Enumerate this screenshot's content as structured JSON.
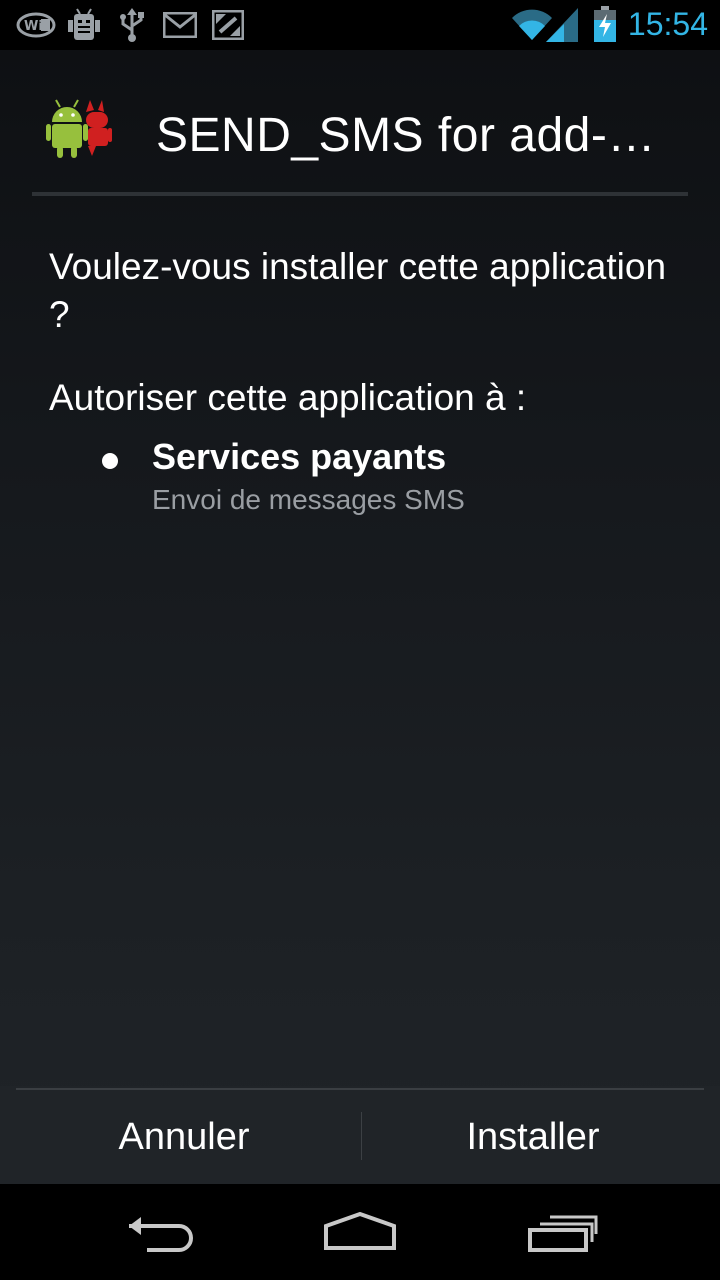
{
  "status_bar": {
    "time": "15:54",
    "wifi_label": "Wi",
    "icons": [
      "wifi-direct-icon",
      "debug-icon",
      "usb-icon",
      "gmail-icon",
      "screenshot-icon",
      "wifi-signal-icon",
      "cell-signal-icon",
      "battery-charging-icon"
    ],
    "accent_color": "#33b5e5"
  },
  "dialog": {
    "app_icon": "android-app-icon",
    "title": "SEND_SMS for add-…",
    "question": "Voulez-vous installer cette application ?",
    "permissions_heading": "Autoriser cette application à :",
    "permissions": [
      {
        "title": "Services payants",
        "description": "Envoi de messages SMS"
      }
    ]
  },
  "buttons": {
    "cancel": "Annuler",
    "install": "Installer"
  },
  "nav_bar": {
    "icons": [
      "back-icon",
      "home-icon",
      "recent-apps-icon"
    ]
  }
}
